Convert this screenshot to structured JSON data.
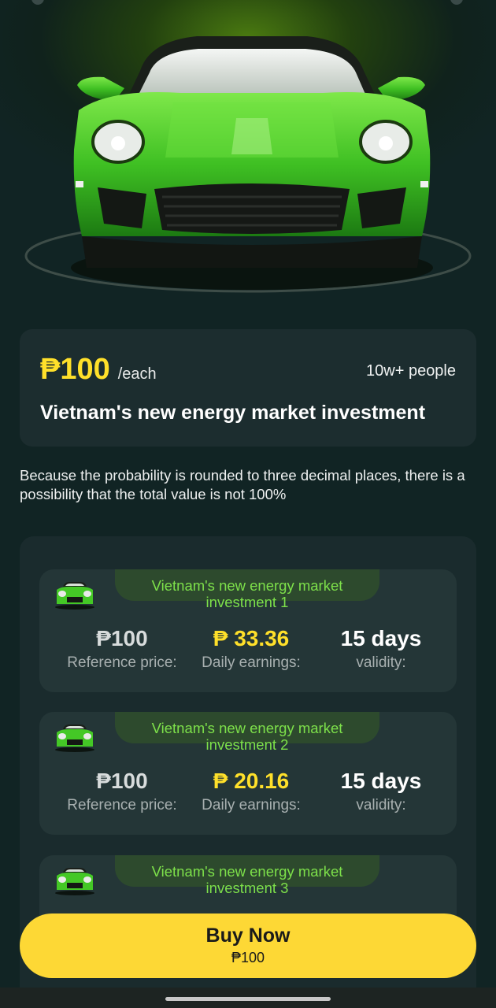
{
  "product": {
    "price": "₱100",
    "unit": "/each",
    "participants": "10w+ people",
    "title": "Vietnam's new energy market investment"
  },
  "note": "Because the probability is rounded to three decimal places, there is a possibility that the total value is not 100%",
  "investments": [
    {
      "name": "Vietnam's new energy market investment 1",
      "reference_price": "₱100",
      "reference_label": "Reference price:",
      "daily_earnings": "₱ 33.36",
      "daily_label": "Daily earnings:",
      "validity": "15 days",
      "validity_label": "validity:"
    },
    {
      "name": "Vietnam's new energy market investment 2",
      "reference_price": "₱100",
      "reference_label": "Reference price:",
      "daily_earnings": "₱ 20.16",
      "daily_label": "Daily earnings:",
      "validity": "15 days",
      "validity_label": "validity:"
    },
    {
      "name": "Vietnam's new energy market investment 3"
    }
  ],
  "buy": {
    "label": "Buy Now",
    "price": "₱100"
  },
  "colors": {
    "background": "#112424",
    "card": "#1c2d2f",
    "accent_yellow": "#ffe02a",
    "accent_green": "#7de04a",
    "button": "#fdd835"
  },
  "icons": {
    "hero": "green-sports-car-image",
    "item": "green-car-icon"
  }
}
